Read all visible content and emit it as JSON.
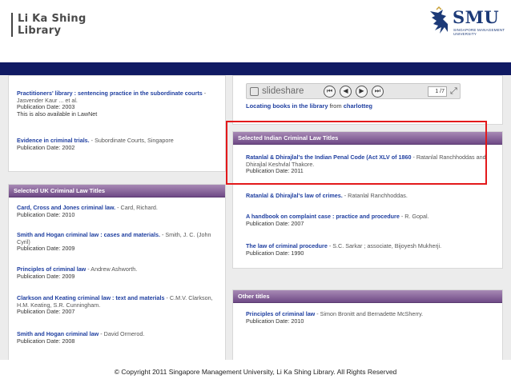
{
  "header": {
    "library_line1": "Li Ka Shing",
    "library_line2": "Library",
    "smu_name": "SMU",
    "smu_sub1": "SINGAPORE MANAGEMENT",
    "smu_sub2": "UNIVERSITY"
  },
  "left_top": {
    "entries": [
      {
        "title": "Practitioners' library : sentencing practice in the subordinate courts",
        "author": " - Jasvender Kaur ... et al.",
        "pub": "Publication Date: 2003",
        "note": "This is also available in LawNet"
      },
      {
        "title": "Evidence in criminal trials.",
        "author": " - Subordinate Courts, Singapore",
        "pub": "Publication Date: 2002"
      }
    ]
  },
  "uk_panel": {
    "title": "Selected UK Criminal Law Titles",
    "entries": [
      {
        "title": "Card, Cross and Jones criminal law.",
        "author": " - Card, Richard.",
        "pub": "Publication Date: 2010"
      },
      {
        "title": "Smith and Hogan criminal law : cases and materials.",
        "author": " - Smith, J. C. (John Cyril)",
        "pub": "Publication Date: 2009"
      },
      {
        "title": "Principles of criminal law",
        "author": " - Andrew Ashworth.",
        "pub": "Publication Date: 2009"
      },
      {
        "title": "Clarkson and Keating criminal law : text and materials",
        "author": " - C.M.V. Clarkson, H.M. Keating, S.R. Cunningham.",
        "pub": "Publication Date: 2007"
      },
      {
        "title": "Smith and Hogan criminal law",
        "author": " - David Ormerod.",
        "pub": "Publication Date: 2008"
      }
    ]
  },
  "slideshare": {
    "brand": "slideshare",
    "page_indicator": "1 /7",
    "locating_link": "Locating books in the library",
    "locating_from": " from ",
    "locating_user": "charlotteg"
  },
  "indian_panel": {
    "title": "Selected Indian Criminal Law Titles",
    "entries": [
      {
        "title": "Ratanlal & Dhirajlal's the Indian Penal Code (Act XLV of 1860",
        "author": " - Ratanlal Ranchhoddas and Dhirajlal Keshvlal Thakore.",
        "pub": "Publication Date: 2011"
      },
      {
        "title": "Ratanlal & Dhirajlal's law of crimes.",
        "author": " - Ratanlal Ranchhoddas.",
        "pub": ""
      },
      {
        "title": "A handbook on complaint case : practice and procedure",
        "author": " - R. Gopal.",
        "pub": "Publication Date: 2007"
      },
      {
        "title": "The law of criminal procedure",
        "author": " - S.C. Sarkar ; associate, Bijoyesh Mukherji.",
        "pub": "Publication Date: 1990"
      }
    ]
  },
  "other_panel": {
    "title": "Other titles",
    "entries": [
      {
        "title": "Principles of criminal law",
        "author": " - Simon Bronitt and Bernadette McSherry.",
        "pub": "Publication Date: 2010"
      }
    ]
  },
  "footer": {
    "copyright": "© Copyright 2011 Singapore Management University, Li Ka Shing Library. All Rights Reserved"
  },
  "colors": {
    "navy_bar": "#101a63",
    "panel_header": "#6f4a86",
    "link": "#1f3fa0",
    "highlight": "#e3191b"
  }
}
